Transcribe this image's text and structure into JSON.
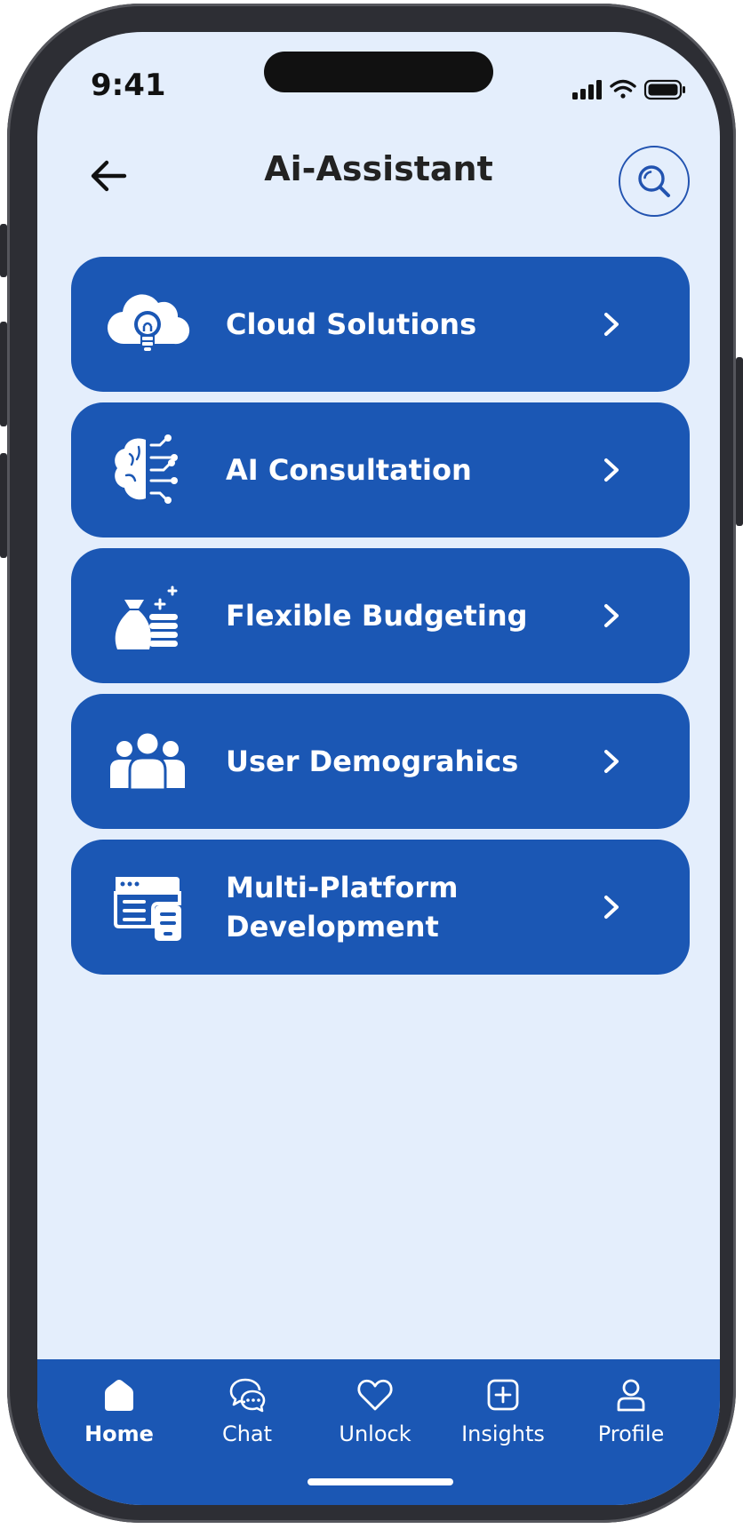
{
  "status_bar": {
    "time": "9:41"
  },
  "header": {
    "title": "Ai-Assistant"
  },
  "menu_items": [
    {
      "label": "Cloud Solutions",
      "icon": "cloud-bulb-icon"
    },
    {
      "label": "AI Consultation",
      "icon": "ai-brain-icon"
    },
    {
      "label": "Flexible Budgeting",
      "icon": "money-bag-icon"
    },
    {
      "label": "User Demograhics",
      "icon": "users-group-icon"
    },
    {
      "label": "Multi-Platform Development",
      "icon": "multi-platform-icon"
    }
  ],
  "bottom_nav": {
    "items": [
      {
        "label": "Home",
        "icon": "home-icon",
        "active": true
      },
      {
        "label": "Chat",
        "icon": "chat-icon"
      },
      {
        "label": "Unlock",
        "icon": "heart-icon"
      },
      {
        "label": "Insights",
        "icon": "plus-square-icon"
      },
      {
        "label": "Profile",
        "icon": "profile-icon"
      }
    ]
  },
  "colors": {
    "accent": "#1b57b4",
    "background": "#e4eefc",
    "text_dark": "#222222",
    "text_light": "#ffffff"
  }
}
